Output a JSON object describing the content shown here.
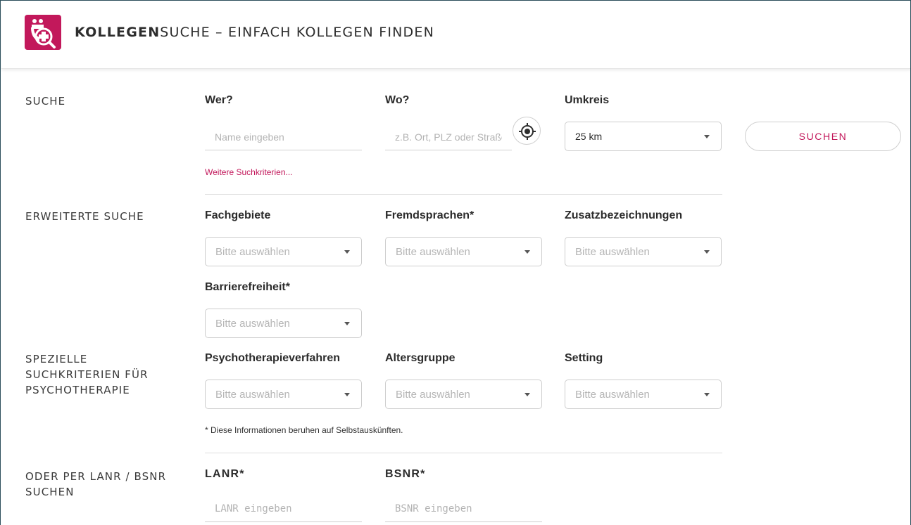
{
  "header": {
    "title_bold": "KOLLEGEN",
    "title_rest": "SUCHE – EINFACH KOLLEGEN FINDEN",
    "logo_icon": "doctor-search-icon",
    "brand_color": "#c2185b"
  },
  "search": {
    "section_label": "SUCHE",
    "who": {
      "label": "Wer?",
      "placeholder": "Name eingeben"
    },
    "where": {
      "label": "Wo?",
      "placeholder": "z.B. Ort, PLZ oder Straße"
    },
    "radius": {
      "label": "Umkreis",
      "value": "25 km"
    },
    "locate_icon": "crosshair-location-icon",
    "submit_label": "SUCHEN",
    "more_link": "Weitere Suchkriterien..."
  },
  "extended": {
    "section_label": "ERWEITERTE SUCHE",
    "fields": [
      {
        "label": "Fachgebiete",
        "placeholder": "Bitte auswählen"
      },
      {
        "label": "Fremdsprachen*",
        "placeholder": "Bitte auswählen"
      },
      {
        "label": "Zusatzbezeichnungen",
        "placeholder": "Bitte auswählen"
      },
      {
        "label": "Barrierefreiheit*",
        "placeholder": "Bitte auswählen"
      }
    ]
  },
  "psycho": {
    "section_label_lines": [
      "SPEZIELLE",
      "SUCHKRITERIEN FÜR",
      "PSYCHOTHERAPIE"
    ],
    "fields": [
      {
        "label": "Psychotherapieverfahren",
        "placeholder": "Bitte auswählen"
      },
      {
        "label": "Altersgruppe",
        "placeholder": "Bitte auswählen"
      },
      {
        "label": "Setting",
        "placeholder": "Bitte auswählen"
      }
    ],
    "note": "* Diese Informationen beruhen auf Selbstauskünften."
  },
  "lanr": {
    "section_label_lines": [
      "ODER PER LANR / BSNR",
      "SUCHEN"
    ],
    "lanr": {
      "label": "LANR*",
      "placeholder": "LANR eingeben"
    },
    "bsnr": {
      "label": "BSNR*",
      "placeholder": "BSNR eingeben"
    }
  }
}
